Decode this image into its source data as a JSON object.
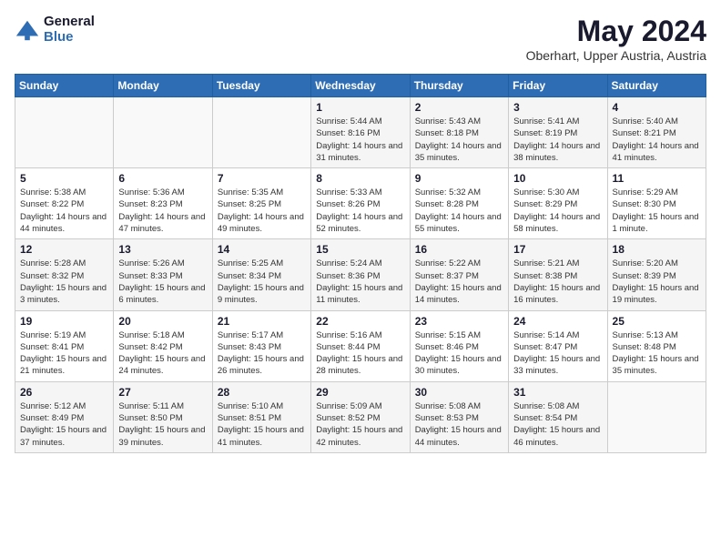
{
  "logo": {
    "general": "General",
    "blue": "Blue"
  },
  "header": {
    "month": "May 2024",
    "location": "Oberhart, Upper Austria, Austria"
  },
  "weekdays": [
    "Sunday",
    "Monday",
    "Tuesday",
    "Wednesday",
    "Thursday",
    "Friday",
    "Saturday"
  ],
  "weeks": [
    [
      {
        "day": "",
        "sunrise": "",
        "sunset": "",
        "daylight": ""
      },
      {
        "day": "",
        "sunrise": "",
        "sunset": "",
        "daylight": ""
      },
      {
        "day": "",
        "sunrise": "",
        "sunset": "",
        "daylight": ""
      },
      {
        "day": "1",
        "sunrise": "Sunrise: 5:44 AM",
        "sunset": "Sunset: 8:16 PM",
        "daylight": "Daylight: 14 hours and 31 minutes."
      },
      {
        "day": "2",
        "sunrise": "Sunrise: 5:43 AM",
        "sunset": "Sunset: 8:18 PM",
        "daylight": "Daylight: 14 hours and 35 minutes."
      },
      {
        "day": "3",
        "sunrise": "Sunrise: 5:41 AM",
        "sunset": "Sunset: 8:19 PM",
        "daylight": "Daylight: 14 hours and 38 minutes."
      },
      {
        "day": "4",
        "sunrise": "Sunrise: 5:40 AM",
        "sunset": "Sunset: 8:21 PM",
        "daylight": "Daylight: 14 hours and 41 minutes."
      }
    ],
    [
      {
        "day": "5",
        "sunrise": "Sunrise: 5:38 AM",
        "sunset": "Sunset: 8:22 PM",
        "daylight": "Daylight: 14 hours and 44 minutes."
      },
      {
        "day": "6",
        "sunrise": "Sunrise: 5:36 AM",
        "sunset": "Sunset: 8:23 PM",
        "daylight": "Daylight: 14 hours and 47 minutes."
      },
      {
        "day": "7",
        "sunrise": "Sunrise: 5:35 AM",
        "sunset": "Sunset: 8:25 PM",
        "daylight": "Daylight: 14 hours and 49 minutes."
      },
      {
        "day": "8",
        "sunrise": "Sunrise: 5:33 AM",
        "sunset": "Sunset: 8:26 PM",
        "daylight": "Daylight: 14 hours and 52 minutes."
      },
      {
        "day": "9",
        "sunrise": "Sunrise: 5:32 AM",
        "sunset": "Sunset: 8:28 PM",
        "daylight": "Daylight: 14 hours and 55 minutes."
      },
      {
        "day": "10",
        "sunrise": "Sunrise: 5:30 AM",
        "sunset": "Sunset: 8:29 PM",
        "daylight": "Daylight: 14 hours and 58 minutes."
      },
      {
        "day": "11",
        "sunrise": "Sunrise: 5:29 AM",
        "sunset": "Sunset: 8:30 PM",
        "daylight": "Daylight: 15 hours and 1 minute."
      }
    ],
    [
      {
        "day": "12",
        "sunrise": "Sunrise: 5:28 AM",
        "sunset": "Sunset: 8:32 PM",
        "daylight": "Daylight: 15 hours and 3 minutes."
      },
      {
        "day": "13",
        "sunrise": "Sunrise: 5:26 AM",
        "sunset": "Sunset: 8:33 PM",
        "daylight": "Daylight: 15 hours and 6 minutes."
      },
      {
        "day": "14",
        "sunrise": "Sunrise: 5:25 AM",
        "sunset": "Sunset: 8:34 PM",
        "daylight": "Daylight: 15 hours and 9 minutes."
      },
      {
        "day": "15",
        "sunrise": "Sunrise: 5:24 AM",
        "sunset": "Sunset: 8:36 PM",
        "daylight": "Daylight: 15 hours and 11 minutes."
      },
      {
        "day": "16",
        "sunrise": "Sunrise: 5:22 AM",
        "sunset": "Sunset: 8:37 PM",
        "daylight": "Daylight: 15 hours and 14 minutes."
      },
      {
        "day": "17",
        "sunrise": "Sunrise: 5:21 AM",
        "sunset": "Sunset: 8:38 PM",
        "daylight": "Daylight: 15 hours and 16 minutes."
      },
      {
        "day": "18",
        "sunrise": "Sunrise: 5:20 AM",
        "sunset": "Sunset: 8:39 PM",
        "daylight": "Daylight: 15 hours and 19 minutes."
      }
    ],
    [
      {
        "day": "19",
        "sunrise": "Sunrise: 5:19 AM",
        "sunset": "Sunset: 8:41 PM",
        "daylight": "Daylight: 15 hours and 21 minutes."
      },
      {
        "day": "20",
        "sunrise": "Sunrise: 5:18 AM",
        "sunset": "Sunset: 8:42 PM",
        "daylight": "Daylight: 15 hours and 24 minutes."
      },
      {
        "day": "21",
        "sunrise": "Sunrise: 5:17 AM",
        "sunset": "Sunset: 8:43 PM",
        "daylight": "Daylight: 15 hours and 26 minutes."
      },
      {
        "day": "22",
        "sunrise": "Sunrise: 5:16 AM",
        "sunset": "Sunset: 8:44 PM",
        "daylight": "Daylight: 15 hours and 28 minutes."
      },
      {
        "day": "23",
        "sunrise": "Sunrise: 5:15 AM",
        "sunset": "Sunset: 8:46 PM",
        "daylight": "Daylight: 15 hours and 30 minutes."
      },
      {
        "day": "24",
        "sunrise": "Sunrise: 5:14 AM",
        "sunset": "Sunset: 8:47 PM",
        "daylight": "Daylight: 15 hours and 33 minutes."
      },
      {
        "day": "25",
        "sunrise": "Sunrise: 5:13 AM",
        "sunset": "Sunset: 8:48 PM",
        "daylight": "Daylight: 15 hours and 35 minutes."
      }
    ],
    [
      {
        "day": "26",
        "sunrise": "Sunrise: 5:12 AM",
        "sunset": "Sunset: 8:49 PM",
        "daylight": "Daylight: 15 hours and 37 minutes."
      },
      {
        "day": "27",
        "sunrise": "Sunrise: 5:11 AM",
        "sunset": "Sunset: 8:50 PM",
        "daylight": "Daylight: 15 hours and 39 minutes."
      },
      {
        "day": "28",
        "sunrise": "Sunrise: 5:10 AM",
        "sunset": "Sunset: 8:51 PM",
        "daylight": "Daylight: 15 hours and 41 minutes."
      },
      {
        "day": "29",
        "sunrise": "Sunrise: 5:09 AM",
        "sunset": "Sunset: 8:52 PM",
        "daylight": "Daylight: 15 hours and 42 minutes."
      },
      {
        "day": "30",
        "sunrise": "Sunrise: 5:08 AM",
        "sunset": "Sunset: 8:53 PM",
        "daylight": "Daylight: 15 hours and 44 minutes."
      },
      {
        "day": "31",
        "sunrise": "Sunrise: 5:08 AM",
        "sunset": "Sunset: 8:54 PM",
        "daylight": "Daylight: 15 hours and 46 minutes."
      },
      {
        "day": "",
        "sunrise": "",
        "sunset": "",
        "daylight": ""
      }
    ]
  ]
}
